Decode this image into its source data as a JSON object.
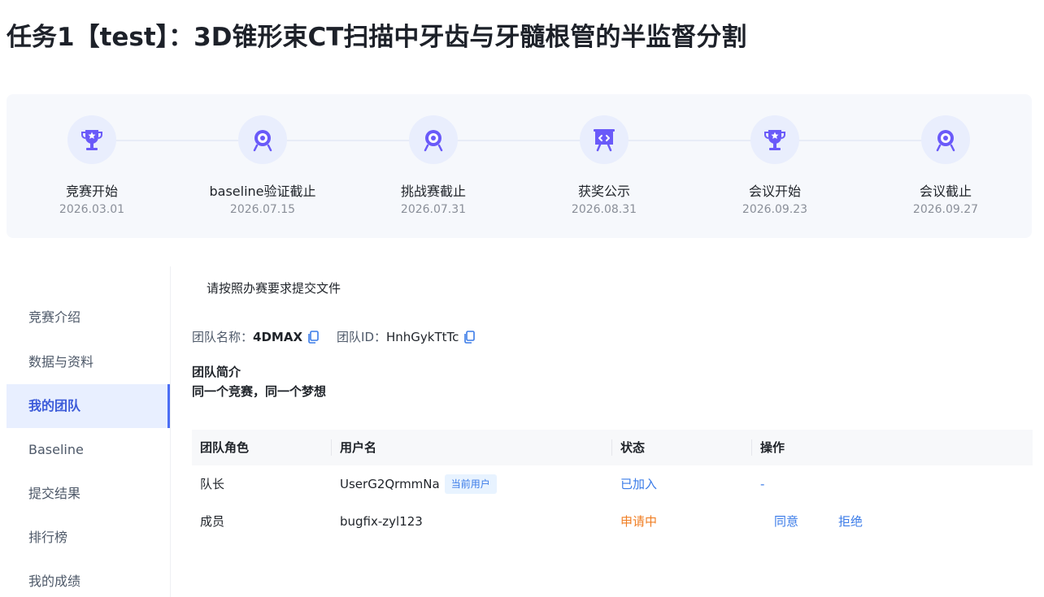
{
  "page": {
    "title": "任务1【test】：3D锥形束CT扫描中牙齿与牙髓根管的半监督分割"
  },
  "timeline": [
    {
      "label": "竞赛开始",
      "date": "2026.03.01",
      "icon": "trophy-icon"
    },
    {
      "label": "baseline验证截止",
      "date": "2026.07.15",
      "icon": "target-icon"
    },
    {
      "label": "挑战赛截止",
      "date": "2026.07.31",
      "icon": "target-icon"
    },
    {
      "label": "获奖公示",
      "date": "2026.08.31",
      "icon": "presentation-board-icon"
    },
    {
      "label": "会议开始",
      "date": "2026.09.23",
      "icon": "trophy-icon"
    },
    {
      "label": "会议截止",
      "date": "2026.09.27",
      "icon": "target-icon"
    }
  ],
  "sidebar": {
    "items": [
      {
        "label": "竞赛介绍"
      },
      {
        "label": "数据与资料"
      },
      {
        "label": "我的团队"
      },
      {
        "label": "Baseline"
      },
      {
        "label": "提交结果"
      },
      {
        "label": "排行榜"
      },
      {
        "label": "我的成绩"
      }
    ],
    "active": "我的团队"
  },
  "main": {
    "note": "请按照办赛要求提交文件",
    "team": {
      "name_label": "团队名称：",
      "name": "4DMAX",
      "id_label": "团队ID：",
      "id": "HnhGykTtTc",
      "intro_title": "团队简介",
      "intro_text": "同一个竞赛，同一个梦想"
    },
    "table": {
      "headers": [
        "团队角色",
        "用户名",
        "状态",
        "操作"
      ],
      "rows": [
        {
          "role": "队长",
          "username": "UserG2QrmmNa",
          "badge": "当前用户",
          "status": "已加入",
          "action": "-"
        },
        {
          "role": "成员",
          "username": "bugfix-zyl123",
          "status": "申请中",
          "approve": "同意",
          "reject": "拒绝"
        }
      ]
    }
  },
  "colors": {
    "accent": "#4b6ef5",
    "link": "#3a7be8",
    "pending": "#f07e23",
    "icon_purple": "#6a5af9"
  }
}
